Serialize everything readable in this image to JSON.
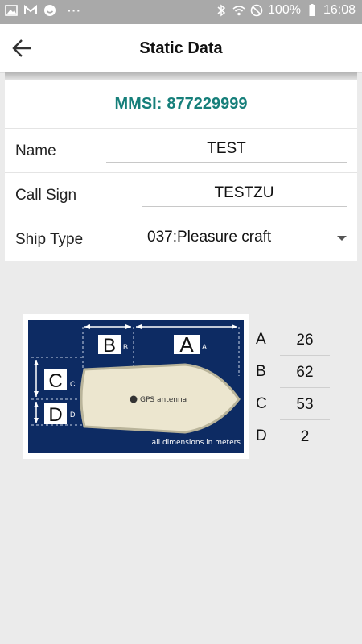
{
  "status_bar": {
    "battery": "100%",
    "time": "16:08",
    "dots": "···"
  },
  "header": {
    "title": "Static Data"
  },
  "card": {
    "mmsi_label": "MMSI:",
    "mmsi_value": "877229999",
    "fields": [
      {
        "label": "Name",
        "value": "TEST"
      },
      {
        "label": "Call Sign",
        "value": "TESTZU"
      },
      {
        "label": "Ship Type",
        "value": "037:Pleasure craft"
      }
    ]
  },
  "diagram": {
    "label_a": "A",
    "label_b": "B",
    "label_c": "C",
    "label_d": "D",
    "small_a": "A",
    "small_b": "B",
    "small_c": "C",
    "small_d": "D",
    "antenna": "GPS antenna",
    "note": "all dimensions in meters"
  },
  "dimensions": [
    {
      "label": "A",
      "value": "26"
    },
    {
      "label": "B",
      "value": "62"
    },
    {
      "label": "C",
      "value": "53"
    },
    {
      "label": "D",
      "value": "2"
    }
  ],
  "colors": {
    "accent": "#167f7a",
    "status_bar": "#a9a9a9",
    "diagram_bg": "#0d2b63",
    "hull": "#ece6cf"
  }
}
